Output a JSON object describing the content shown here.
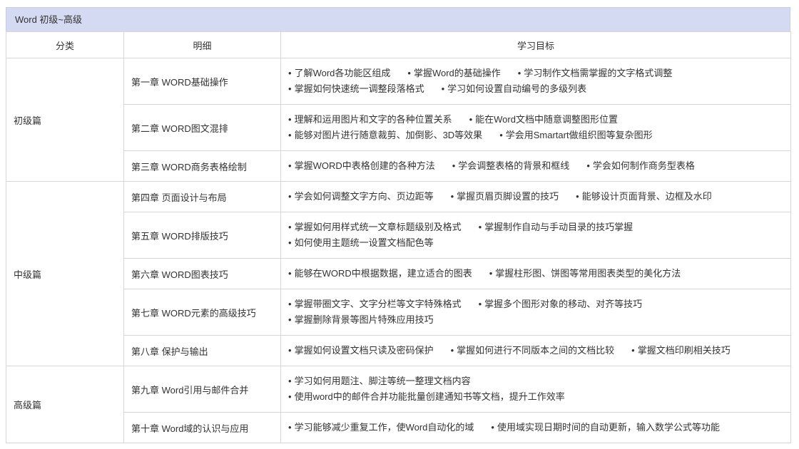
{
  "header": {
    "title": "Word 初级~高级"
  },
  "columns": [
    "分类",
    "明细",
    "学习目标"
  ],
  "bullet": "•",
  "sections": [
    {
      "category": "初级篇",
      "chapters": [
        {
          "title": "第一章 WORD基础操作",
          "lines": [
            [
              "了解Word各功能区组成",
              "掌握Word的基础操作",
              "学习制作文档需掌握的文字格式调整"
            ],
            [
              "掌握如何快速统一调整段落格式",
              "学习如何设置自动编号的多级列表"
            ]
          ]
        },
        {
          "title": "第二章 WORD图文混排",
          "lines": [
            [
              "理解和运用图片和文字的各种位置关系",
              "能在Word文档中随意调整图形位置"
            ],
            [
              "能够对图片进行随意裁剪、加倒影、3D等效果",
              "学会用Smartart做组织图等复杂图形"
            ]
          ]
        },
        {
          "title": "第三章 WORD商务表格绘制",
          "lines": [
            [
              "掌握WORD中表格创建的各种方法",
              "学会调整表格的背景和框线",
              "学会如何制作商务型表格"
            ]
          ]
        }
      ]
    },
    {
      "category": "中级篇",
      "chapters": [
        {
          "title": "第四章 页面设计与布局",
          "lines": [
            [
              "学会如何调整文字方向、页边距等",
              "掌握页眉页脚设置的技巧",
              "能够设计页面背景、边框及水印"
            ]
          ]
        },
        {
          "title": "第五章 WORD排版技巧",
          "lines": [
            [
              "掌握如何用样式统一文章标题级别及格式",
              "掌握制作自动与手动目录的技巧掌握"
            ],
            [
              "如何使用主题统一设置文档配色等"
            ]
          ]
        },
        {
          "title": "第六章 WORD图表技巧",
          "lines": [
            [
              "能够在WORD中根据数据，建立适合的图表",
              "掌握柱形图、饼图等常用图表类型的美化方法"
            ]
          ]
        },
        {
          "title": "第七章 WORD元素的高级技巧",
          "lines": [
            [
              "掌握带圈文字、文字分栏等文字特殊格式",
              "掌握多个图形对象的移动、对齐等技巧"
            ],
            [
              "掌握删除背景等图片特殊应用技巧"
            ]
          ]
        },
        {
          "title": "第八章 保护与输出",
          "lines": [
            [
              "掌握如何设置文档只读及密码保护",
              "掌握如何进行不同版本之间的文档比较",
              "掌握文档印刷相关技巧"
            ]
          ]
        }
      ]
    },
    {
      "category": "高级篇",
      "chapters": [
        {
          "title": "第九章 Word引用与邮件合并",
          "lines": [
            [
              "学习如何用题注、脚注等统一整理文档内容"
            ],
            [
              "使用word中的邮件合并功能批量创建通知书等文档，提升工作效率"
            ]
          ]
        },
        {
          "title": "第十章 Word域的认识与应用",
          "lines": [
            [
              "学习能够减少重复工作，使Word自动化的域",
              "使用域实现日期时间的自动更新，输入数学公式等功能"
            ]
          ]
        }
      ]
    }
  ]
}
